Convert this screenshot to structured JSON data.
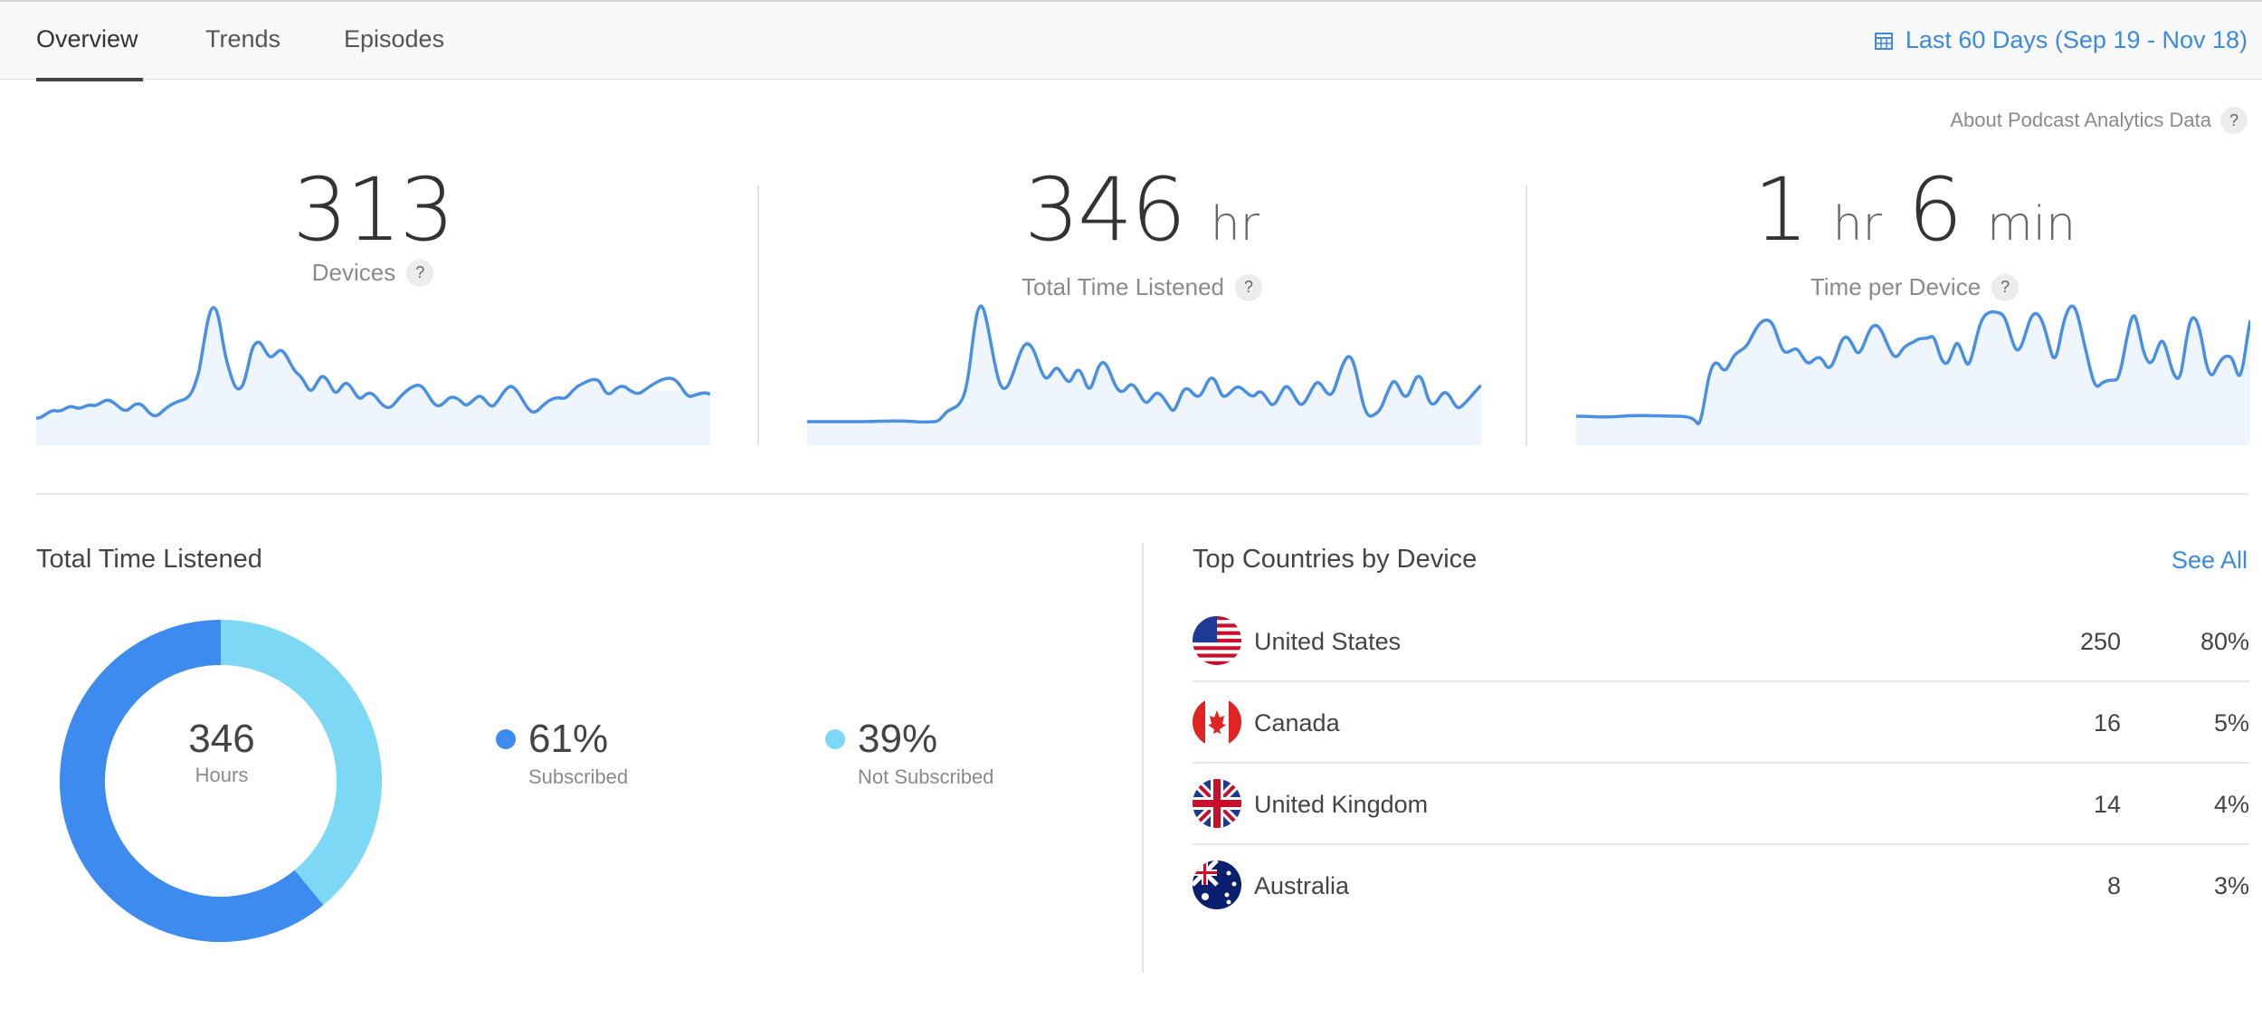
{
  "tabs": [
    {
      "label": "Overview",
      "active": true
    },
    {
      "label": "Trends",
      "active": false
    },
    {
      "label": "Episodes",
      "active": false
    }
  ],
  "date_range": {
    "label": "Last 60 Days (Sep 19 - Nov 18)",
    "icon": "calendar-icon"
  },
  "about_link": {
    "label": "About Podcast Analytics Data",
    "help": "?"
  },
  "metrics": [
    {
      "value": "313",
      "unit": "",
      "label": "Devices",
      "help": "?"
    },
    {
      "value": "346",
      "unit": "hr",
      "label": "Total Time Listened",
      "help": "?"
    },
    {
      "value": "1",
      "unit": "hr",
      "value2": "6",
      "unit2": "min",
      "label": "Time per Device",
      "help": "?"
    }
  ],
  "total_time": {
    "title": "Total Time Listened",
    "center_value": "346",
    "center_label": "Hours",
    "segments": [
      {
        "pct": "61%",
        "label": "Subscribed",
        "fraction": 0.61,
        "color": "#3d8bef"
      },
      {
        "pct": "39%",
        "label": "Not Subscribed",
        "fraction": 0.39,
        "color": "#7dd8f5"
      }
    ]
  },
  "countries": {
    "title": "Top Countries by Device",
    "see_all": "See All",
    "rows": [
      {
        "name": "United States",
        "count": "250",
        "pct": "80%",
        "flag": "us-flag-icon"
      },
      {
        "name": "Canada",
        "count": "16",
        "pct": "5%",
        "flag": "canada-flag-icon"
      },
      {
        "name": "United Kingdom",
        "count": "14",
        "pct": "4%",
        "flag": "uk-flag-icon"
      },
      {
        "name": "Australia",
        "count": "8",
        "pct": "3%",
        "flag": "australia-flag-icon"
      }
    ]
  },
  "colors": {
    "accent": "#3b8ae0",
    "spark_line": "#4a90e2",
    "spark_fill": "#eef5fd"
  }
}
